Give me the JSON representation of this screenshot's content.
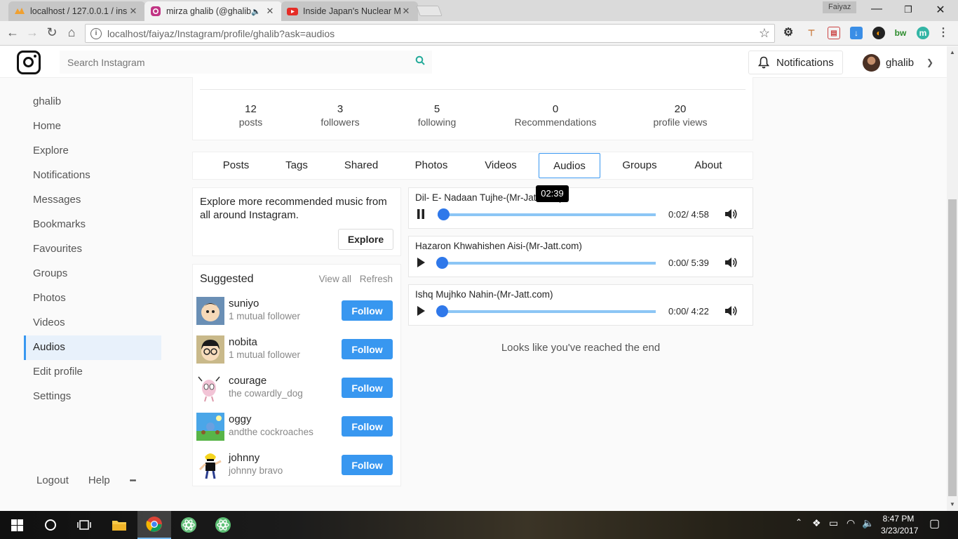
{
  "browser": {
    "tabs": [
      {
        "title": "localhost / 127.0.0.1 / ins"
      },
      {
        "title": "mirza ghalib (@ghalib"
      },
      {
        "title": "Inside Japan's Nuclear M"
      }
    ],
    "profile_chip": "Faiyaz",
    "url_host": "localhost",
    "url_path": "/faiyaz/Instagram/profile/ghalib?ask=audios"
  },
  "header": {
    "search_placeholder": "Search Instagram",
    "notifications_label": "Notifications",
    "username": "ghalib"
  },
  "sidebar": {
    "items": [
      {
        "label": "ghalib"
      },
      {
        "label": "Home"
      },
      {
        "label": "Explore"
      },
      {
        "label": "Notifications"
      },
      {
        "label": "Messages"
      },
      {
        "label": "Bookmarks"
      },
      {
        "label": "Favourites"
      },
      {
        "label": "Groups"
      },
      {
        "label": "Photos"
      },
      {
        "label": "Videos"
      },
      {
        "label": "Audios"
      },
      {
        "label": "Edit profile"
      },
      {
        "label": "Settings"
      }
    ],
    "footer": {
      "logout": "Logout",
      "help": "Help",
      "more": "•••"
    }
  },
  "stats": [
    {
      "num": "12",
      "label": "posts"
    },
    {
      "num": "3",
      "label": "followers"
    },
    {
      "num": "5",
      "label": "following"
    },
    {
      "num": "0",
      "label": "Recommendations"
    },
    {
      "num": "20",
      "label": "profile views"
    }
  ],
  "profile_tabs": [
    "Posts",
    "Tags",
    "Shared",
    "Photos",
    "Videos",
    "Audios",
    "Groups",
    "About"
  ],
  "explore_card": {
    "text": "Explore more recommended music from all around Instagram.",
    "button": "Explore"
  },
  "suggested": {
    "title": "Suggested",
    "view_all": "View all",
    "refresh": "Refresh",
    "follow_label": "Follow",
    "users": [
      {
        "name": "suniyo",
        "sub": "1 mutual follower"
      },
      {
        "name": "nobita",
        "sub": "1 mutual follower"
      },
      {
        "name": "courage",
        "sub": "the cowardly_dog"
      },
      {
        "name": "oggy",
        "sub": "andthe cockroaches"
      },
      {
        "name": "johnny",
        "sub": "johnny bravo"
      }
    ]
  },
  "audios": [
    {
      "title": "Dil- E- Nadaan Tujhe-(Mr-Jatt.com)",
      "time": "0:02/ 4:58",
      "playing": true,
      "progress": 0.007
    },
    {
      "title": "Hazaron Khwahishen Aisi-(Mr-Jatt.com)",
      "time": "0:00/ 5:39",
      "playing": false,
      "progress": 0
    },
    {
      "title": "Ishq Mujhko Nahin-(Mr-Jatt.com)",
      "time": "0:00/ 4:22",
      "playing": false,
      "progress": 0
    }
  ],
  "seek_tooltip": "02:39",
  "end_message": "Looks like you've reached the end",
  "taskbar": {
    "time": "8:47 PM",
    "date": "3/23/2017"
  },
  "colors": {
    "accent": "#3897f0",
    "player_knob": "#2f78ea",
    "player_track": "#8cc6f5"
  }
}
